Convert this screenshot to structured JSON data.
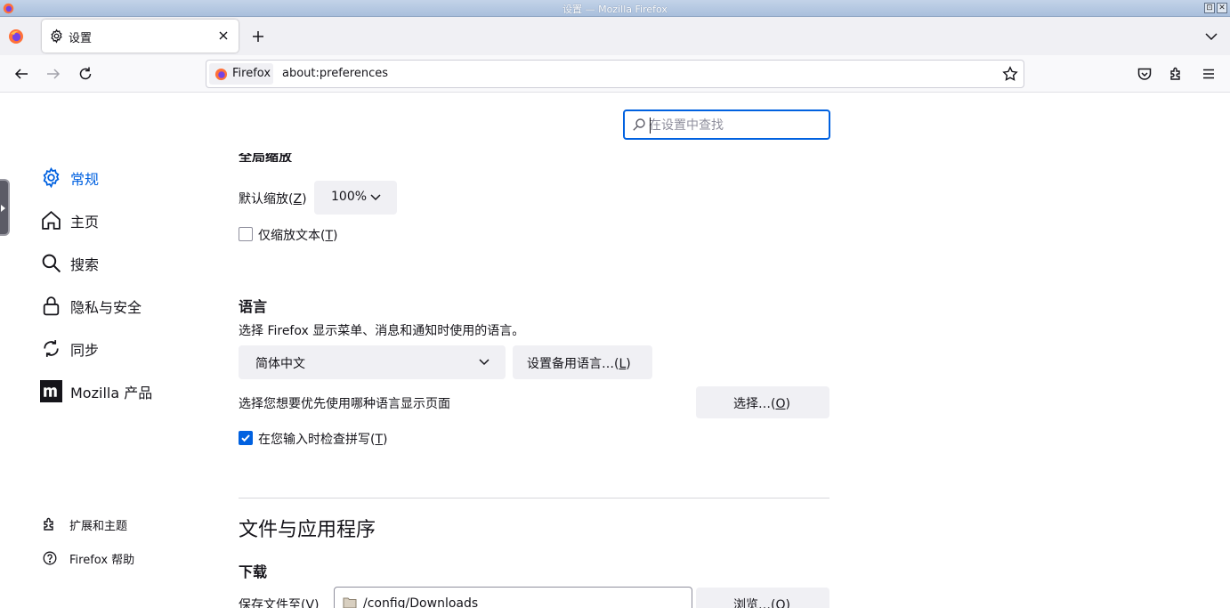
{
  "window": {
    "title": "设置 — Mozilla Firefox",
    "buttons": [
      "⊡",
      "✕"
    ]
  },
  "tabs": [
    {
      "label": "设置",
      "icon": "gear-icon",
      "active": true
    }
  ],
  "navbar": {
    "identity_label": "Firefox",
    "url": "about:preferences"
  },
  "search": {
    "placeholder": "在设置中查找",
    "value": ""
  },
  "sidebar": {
    "items": [
      {
        "label": "常规",
        "icon": "gear-icon",
        "active": true
      },
      {
        "label": "主页",
        "icon": "home-icon"
      },
      {
        "label": "搜索",
        "icon": "search-icon"
      },
      {
        "label": "隐私与安全",
        "icon": "lock-icon"
      },
      {
        "label": "同步",
        "icon": "sync-icon"
      },
      {
        "label": "Mozilla 产品",
        "icon": "mozilla-icon"
      }
    ],
    "footer": [
      {
        "label": "扩展和主题",
        "icon": "puzzle-icon"
      },
      {
        "label": "Firefox 帮助",
        "icon": "help-icon"
      }
    ]
  },
  "zoom": {
    "clipped_heading": "全局缩放",
    "default_label": "默认缩放",
    "default_key": "Z",
    "value": "100%",
    "text_only_label": "仅缩放文本",
    "text_only_key": "T",
    "text_only_checked": false
  },
  "language": {
    "heading": "语言",
    "description": "选择 Firefox 显示菜单、消息和通知时使用的语言。",
    "selected": "简体中文",
    "alternatives_label": "设置备用语言…",
    "alternatives_key": "L",
    "pages_label": "选择您想要优先使用哪种语言显示页面",
    "choose_label": "选择…",
    "choose_key": "O",
    "spellcheck_label": "在您输入时检查拼写",
    "spellcheck_key": "T",
    "spellcheck_checked": true
  },
  "files": {
    "heading": "文件与应用程序",
    "downloads_heading": "下载",
    "save_to_label": "保存文件至",
    "save_to_key": "V",
    "path": "/config/Downloads",
    "browse_label": "浏览…",
    "browse_key": "O"
  },
  "colors": {
    "accent": "#0061e0",
    "button_bg": "#f0f0f4",
    "text": "#15141a"
  }
}
